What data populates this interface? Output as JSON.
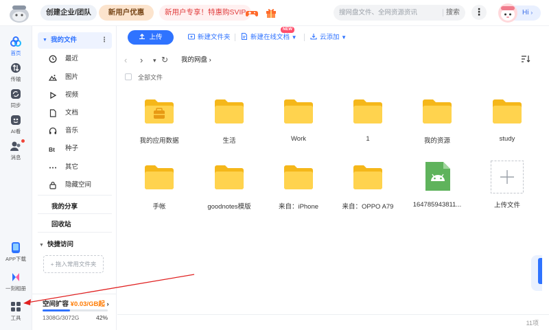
{
  "topbar": {
    "logo_icon": "baidu-netdisk-mascot",
    "team_label": "创建企业/团队",
    "new_user_label": "新用户优惠",
    "promo_label": "新用户专享！特惠购SVIP",
    "game_icon": "gamepad-icon",
    "gift_icon": "gift-icon",
    "search_placeholder": "搜网盘文件、全网资源资讯",
    "search_button": "搜索",
    "more_icon": "more-vertical-icon",
    "greeting": "Hi",
    "accent": "#2f73ff"
  },
  "rail": {
    "items": [
      {
        "label": "首页",
        "icon": "home-icon"
      },
      {
        "label": "传输",
        "icon": "transfer-icon"
      },
      {
        "label": "同步",
        "icon": "sync-icon"
      },
      {
        "label": "AI看",
        "icon": "ai-icon"
      },
      {
        "label": "消息",
        "icon": "message-icon"
      }
    ],
    "bottom": [
      {
        "label": "APP下载",
        "icon": "phone-icon"
      },
      {
        "label": "一刻相册",
        "icon": "album-icon"
      },
      {
        "label": "工具",
        "icon": "grid-tools-icon"
      }
    ]
  },
  "sidebar": {
    "my_files": "我的文件",
    "categories": [
      {
        "label": "最近",
        "icon": "clock-icon"
      },
      {
        "label": "图片",
        "icon": "image-icon"
      },
      {
        "label": "视频",
        "icon": "video-icon"
      },
      {
        "label": "文档",
        "icon": "document-icon"
      },
      {
        "label": "音乐",
        "icon": "headphones-icon"
      },
      {
        "label": "种子",
        "icon": "bt-icon"
      },
      {
        "label": "其它",
        "icon": "ellipsis-icon"
      },
      {
        "label": "隐藏空间",
        "icon": "lock-icon"
      }
    ],
    "my_share": "我的分享",
    "recycle": "回收站",
    "quick_access": "快捷访问",
    "drag_hint": "+ 拖入常用文件夹",
    "space_title": "空间扩容",
    "space_price": "¥0.03/GB起",
    "space_chevron": "›",
    "usage": "1308G/3072G",
    "usage_pct": "42%",
    "usage_fraction": 0.42
  },
  "toolbar": {
    "upload": "上传",
    "new_folder": "新建文件夹",
    "new_online_doc": "新建在线文档",
    "new_badge": "NEW",
    "cloud_add": "云添加"
  },
  "nav": {
    "back": "‹",
    "forward": "›",
    "dropdown": "▾",
    "refresh": "↻",
    "breadcrumb": "我的网盘",
    "crumb_sep": "›",
    "all_files": "全部文件",
    "count": "11项"
  },
  "files": [
    {
      "name": "我的应用数据",
      "type": "app-folder"
    },
    {
      "name": "生活",
      "type": "folder"
    },
    {
      "name": "Work",
      "type": "folder"
    },
    {
      "name": "1",
      "type": "folder"
    },
    {
      "name": "我的资源",
      "type": "folder"
    },
    {
      "name": "study",
      "type": "folder"
    },
    {
      "name": "手帐",
      "type": "folder"
    },
    {
      "name": "goodnotes模版",
      "type": "folder"
    },
    {
      "name": "来自：iPhone",
      "type": "folder"
    },
    {
      "name": "来自：OPPO A79",
      "type": "folder"
    },
    {
      "name": "164785943811...",
      "type": "apk"
    },
    {
      "name": "上传文件",
      "type": "upload"
    }
  ]
}
